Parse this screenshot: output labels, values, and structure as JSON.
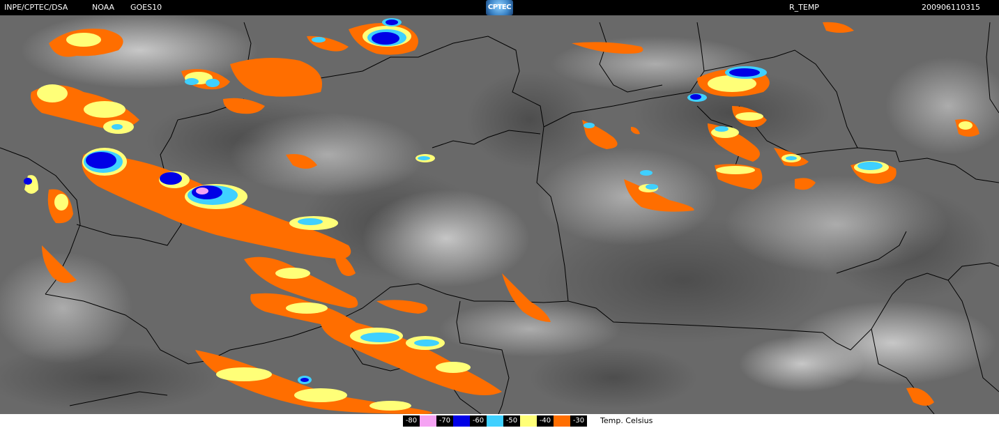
{
  "header": {
    "source": "INPE/CPTEC/DSA",
    "agency": "NOAA",
    "satellite": "GOES10",
    "logo_text": "CPTEC",
    "product": "R_TEMP",
    "timestamp": "200906110315"
  },
  "legend": {
    "caption": "Temp. Celsius",
    "items": [
      {
        "label": "-80",
        "color": "#f5a3f3"
      },
      {
        "label": "-70",
        "color": "#0000e6"
      },
      {
        "label": "-60",
        "color": "#3fd0ff"
      },
      {
        "label": "-50",
        "color": "#ffff78"
      },
      {
        "label": "-40",
        "color": "#ff6e00"
      },
      {
        "label": "-30",
        "color": "#ffffff"
      }
    ]
  },
  "map": {
    "background_color": "#6a6a6a",
    "border_color": "#000000"
  }
}
